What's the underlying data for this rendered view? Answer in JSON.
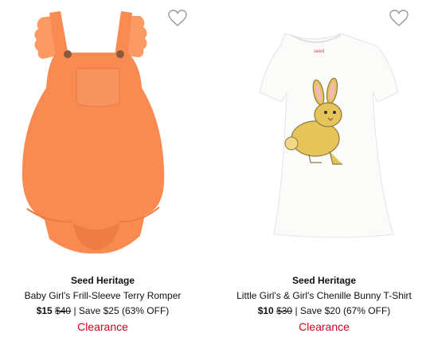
{
  "products": [
    {
      "brand": "Seed Heritage",
      "name": "Baby Girl's Frill-Sleeve Terry Romper",
      "sale_price": "$15",
      "original_price": "$40",
      "savings": "| Save $25 (63% OFF)",
      "badge": "Clearance",
      "wishlist_icon": "heart-outline-icon",
      "image": "orange romper"
    },
    {
      "brand": "Seed Heritage",
      "name": "Little Girl's & Girl's Chenille Bunny T-Shirt",
      "sale_price": "$10",
      "original_price": "$30",
      "savings": "| Save $20 (67% OFF)",
      "badge": "Clearance",
      "wishlist_icon": "heart-outline-icon",
      "image": "white t-shirt with yellow bunny"
    }
  ],
  "colors": {
    "clearance": "#d0021b",
    "romper": "#f98a52",
    "bunny": "#e7c45a"
  }
}
